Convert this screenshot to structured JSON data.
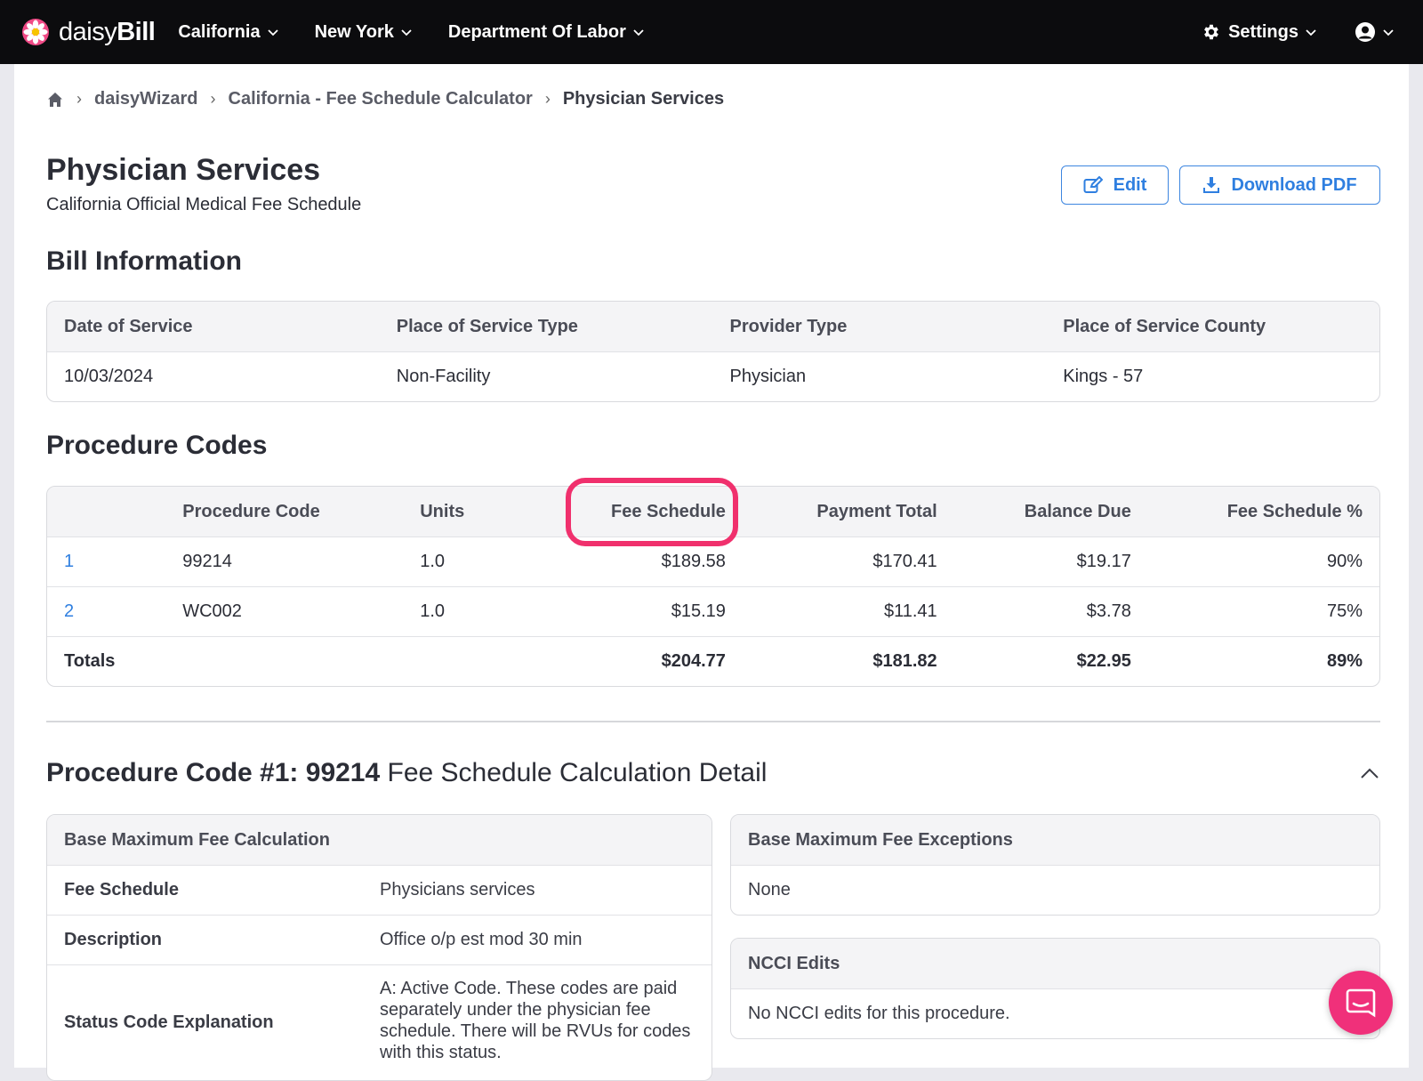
{
  "header": {
    "logo_text_light": "daisy",
    "logo_text_bold": "Bill",
    "nav": [
      {
        "label": "California"
      },
      {
        "label": "New York"
      },
      {
        "label": "Department Of Labor"
      }
    ],
    "settings_label": "Settings"
  },
  "breadcrumb": {
    "items": [
      "daisyWizard",
      "California - Fee Schedule Calculator"
    ],
    "current": "Physician Services"
  },
  "page": {
    "title": "Physician Services",
    "subtitle": "California Official Medical Fee Schedule",
    "edit_label": "Edit",
    "download_label": "Download PDF"
  },
  "bill_info": {
    "title": "Bill Information",
    "headers": [
      "Date of Service",
      "Place of Service Type",
      "Provider Type",
      "Place of Service County"
    ],
    "values": [
      "10/03/2024",
      "Non-Facility",
      "Physician",
      "Kings - 57"
    ]
  },
  "procedures": {
    "title": "Procedure Codes",
    "headers": [
      "",
      "Procedure Code",
      "Units",
      "Fee Schedule",
      "Payment Total",
      "Balance Due",
      "Fee Schedule %"
    ],
    "rows": [
      {
        "num": "1",
        "code": "99214",
        "units": "1.0",
        "fee": "$189.58",
        "payment": "$170.41",
        "balance": "$19.17",
        "pct": "90%"
      },
      {
        "num": "2",
        "code": "WC002",
        "units": "1.0",
        "fee": "$15.19",
        "payment": "$11.41",
        "balance": "$3.78",
        "pct": "75%"
      }
    ],
    "totals": {
      "label": "Totals",
      "fee": "$204.77",
      "payment": "$181.82",
      "balance": "$22.95",
      "pct": "89%"
    }
  },
  "detail": {
    "title_bold": "Procedure Code #1: 99214",
    "title_rest": " Fee Schedule Calculation Detail",
    "calc": {
      "title": "Base Maximum Fee Calculation",
      "rows": [
        {
          "label": "Fee Schedule",
          "value": "Physicians services"
        },
        {
          "label": "Description",
          "value": "Office o/p est mod 30 min"
        },
        {
          "label": "Status Code Explanation",
          "value": "A: Active Code. These codes are paid separately under the physician fee schedule. There will be RVUs for codes with this status."
        }
      ]
    },
    "exceptions": {
      "title": "Base Maximum Fee Exceptions",
      "value": "None"
    },
    "ncci": {
      "title": "NCCI Edits",
      "value": "No NCCI edits for this procedure."
    }
  },
  "colors": {
    "accent": "#2f7fe0",
    "highlight": "#f0306d",
    "topbar": "#0c0c0e"
  }
}
